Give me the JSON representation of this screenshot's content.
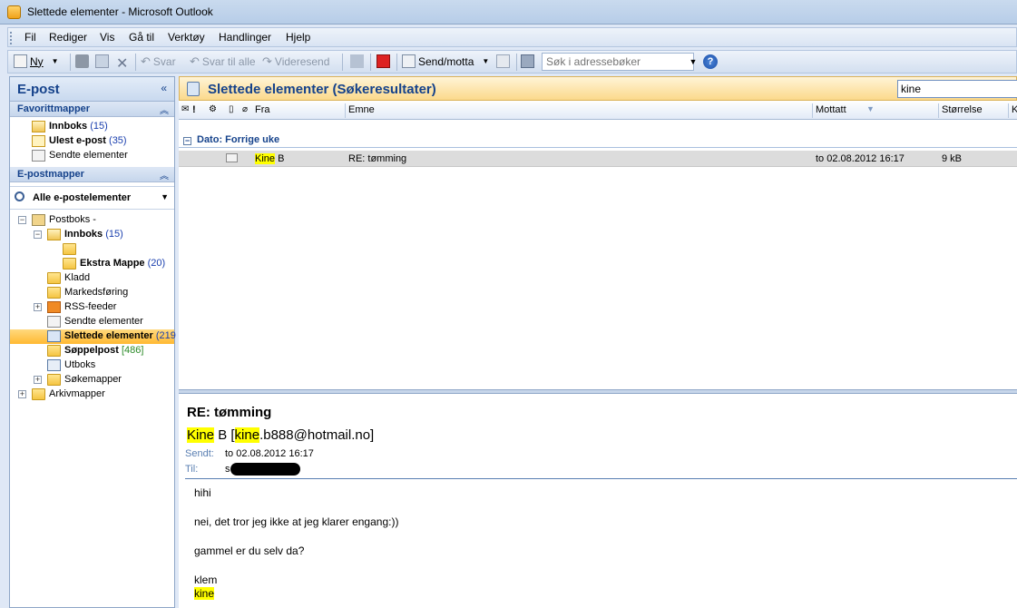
{
  "window": {
    "title": "Slettede elementer - Microsoft Outlook"
  },
  "menu": [
    "Fil",
    "Rediger",
    "Vis",
    "Gå til",
    "Verktøy",
    "Handlinger",
    "Hjelp"
  ],
  "toolbar": {
    "new": "Ny",
    "reply": "Svar",
    "reply_all": "Svar til alle",
    "forward": "Videresend",
    "send_receive": "Send/motta",
    "address_search_placeholder": "Søk i adressebøker"
  },
  "nav": {
    "title": "E-post",
    "favorites_title": "Favorittmapper",
    "favorites": [
      {
        "label": "Innboks",
        "count": "(15)",
        "bold": true
      },
      {
        "label": "Ulest e-post",
        "count": "(35)",
        "bold": true
      },
      {
        "label": "Sendte elementer",
        "count": "",
        "bold": false
      }
    ],
    "mail_folders_title": "E-postmapper",
    "all_mail": "Alle e-postelementer",
    "tree": {
      "mailbox": "Postboks -",
      "inbox": "Innboks",
      "inbox_count": "(15)",
      "extra_folder": "Ekstra Mappe",
      "extra_count": "(20)",
      "drafts": "Kladd",
      "marketing": "Markedsføring",
      "rss": "RSS-feeder",
      "sent": "Sendte elementer",
      "deleted": "Slettede elementer",
      "deleted_count": "(219",
      "junk": "Søppelpost",
      "junk_count": "[486]",
      "outbox": "Utboks",
      "search_folders": "Søkemapper",
      "archive": "Arkivmapper"
    }
  },
  "main": {
    "title": "Slettede elementer (Søkeresultater)",
    "search_value": "kine",
    "columns": {
      "from": "Fra",
      "subject": "Emne",
      "received": "Mottatt",
      "size": "Størrelse",
      "cut": "K"
    },
    "group": "Dato: Forrige uke",
    "rows": [
      {
        "from_hl": "Kine",
        "from_rest": " B",
        "subject": "RE: tømming",
        "received": "to 02.08.2012 16:17",
        "size": "9 kB"
      }
    ]
  },
  "reading": {
    "subject": "RE: tømming",
    "from_name_hl": "Kine",
    "from_mid": " B [",
    "from_email_hl": "kine",
    "from_email_rest": ".b888@hotmail.no]",
    "sent_label": "Sendt:",
    "sent_value": "to 02.08.2012 16:17",
    "to_label": "Til:",
    "to_value": "s",
    "body": [
      "hihi",
      "nei, det tror jeg ikke at jeg klarer engang:))",
      "gammel er du selv da?",
      "klem",
      "kine"
    ]
  },
  "colors": {
    "accent": "#15428b",
    "selection": "#ffb932",
    "highlight": "#ffff00"
  }
}
